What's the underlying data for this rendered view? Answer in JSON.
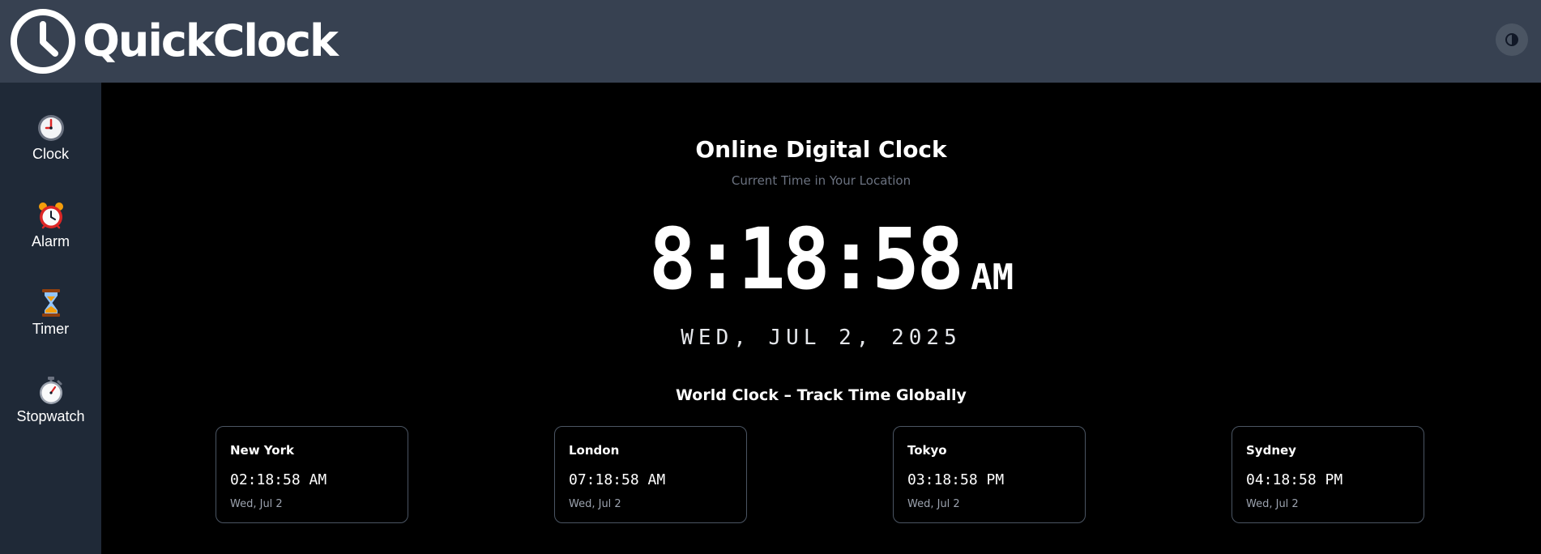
{
  "header": {
    "logo_text": "QuickClock",
    "logo_icon": "clock-icon",
    "theme_toggle_icon": "contrast-icon"
  },
  "sidebar": {
    "items": [
      {
        "label": "Clock",
        "icon": "clock-icon"
      },
      {
        "label": "Alarm",
        "icon": "alarm-clock-icon"
      },
      {
        "label": "Timer",
        "icon": "hourglass-icon"
      },
      {
        "label": "Stopwatch",
        "icon": "stopwatch-icon"
      }
    ]
  },
  "main": {
    "title": "Online Digital Clock",
    "subtitle": "Current Time in Your Location",
    "time": "8:18:58",
    "ampm": "AM",
    "date": "WED, JUL 2, 2025",
    "world_title": "World Clock – Track Time Globally",
    "world_clocks": [
      {
        "city": "New York",
        "time": "02:18:58 AM",
        "date": "Wed, Jul 2"
      },
      {
        "city": "London",
        "time": "07:18:58 AM",
        "date": "Wed, Jul 2"
      },
      {
        "city": "Tokyo",
        "time": "03:18:58 PM",
        "date": "Wed, Jul 2"
      },
      {
        "city": "Sydney",
        "time": "04:18:58 PM",
        "date": "Wed, Jul 2"
      }
    ]
  },
  "colors": {
    "header_bg": "#374151",
    "sidebar_bg": "#1f2937",
    "main_bg": "#000000",
    "card_border": "#4b5563",
    "subtitle": "#6b7280",
    "muted": "#9ca3af"
  }
}
